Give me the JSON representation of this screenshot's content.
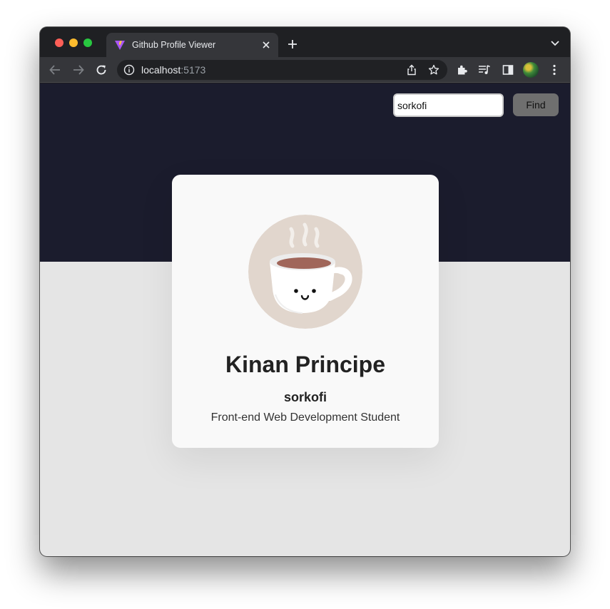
{
  "browser": {
    "tab_title": "Github Profile Viewer",
    "url_host": "localhost",
    "url_port": ":5173",
    "icons": [
      "back-arrow-icon",
      "forward-arrow-icon",
      "reload-icon",
      "info-icon",
      "share-icon",
      "star-icon",
      "extensions-icon",
      "media-icon",
      "side-panel-icon",
      "profile-avatar",
      "kebab-menu-icon",
      "close-icon",
      "plus-icon",
      "chevron-down-icon"
    ],
    "colors": {
      "tab_bg": "#35363a",
      "strip_bg": "#1f2023",
      "omnibox_bg": "#202124"
    }
  },
  "search": {
    "value": "sorkofi",
    "button_label": "Find"
  },
  "profile": {
    "name": "Kinan Principe",
    "login": "sorkofi",
    "bio": "Front-end Web Development Student",
    "avatar_icon": "coffee-cup-avatar"
  },
  "page": {
    "colors": {
      "hero": "#1b1c2d",
      "background": "#e5e5e5",
      "card": "#f9f9f9",
      "button": "#6f6f6f"
    }
  }
}
